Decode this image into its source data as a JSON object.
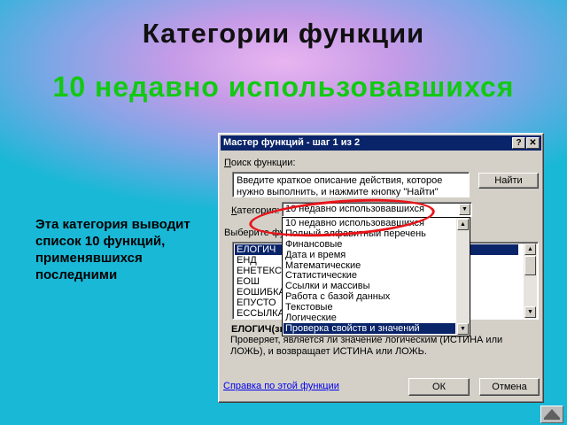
{
  "slide": {
    "title": "Категории функции",
    "subtitle": "10 недавно использовавшихся",
    "note": "Эта категория выводит список 10 функций, применявшихся последними"
  },
  "dialog": {
    "title": "Мастер функций - шаг 1 из 2",
    "help_button": "?",
    "close_button": "✕",
    "search_label_first": "П",
    "search_label_rest": "оиск функции:",
    "search_text": "Введите краткое описание действия, которое нужно выполнить, и нажмите кнопку \"Найти\"",
    "find_button": "Найти",
    "category_label_first": "К",
    "category_label_rest": "атегория:",
    "category_value": "10 недавно использовавшихся",
    "select_label": "Выберите фу",
    "functions": [
      "ЕЛОГИЧ",
      "ЕНД",
      "ЕНЕТЕКСТ",
      "ЕОШ",
      "ЕОШИБКА",
      "ЕПУСТО",
      "ЕССЫЛКА"
    ],
    "selected_function": "ЕЛОГИЧ",
    "signature": "ЕЛОГИЧ(зна",
    "description": "Проверяет, является ли значение логическим (ИСТИНА или ЛОЖЬ), и возвращает ИСТИНА или ЛОЖЬ.",
    "help_link": "Справка по этой функции",
    "ok_button": "ОК",
    "cancel_button": "Отмена"
  },
  "category_dropdown": {
    "items": [
      "10 недавно использовавшихся",
      "Полный алфавитный перечень",
      "Финансовые",
      "Дата и время",
      "Математические",
      "Статистические",
      "Ссылки и массивы",
      "Работа с базой данных",
      "Текстовые",
      "Логические",
      "Проверка свойств и значений"
    ],
    "selected_index": 10
  },
  "colors": {
    "titlebar": "#0a246a",
    "highlight_ellipse": "#e8141a",
    "subtitle": "#12c912"
  },
  "icons": {
    "dropdown_arrow": "triangle-down",
    "scroll_up": "triangle-up",
    "scroll_down": "triangle-down",
    "nav": "home-triangle"
  }
}
